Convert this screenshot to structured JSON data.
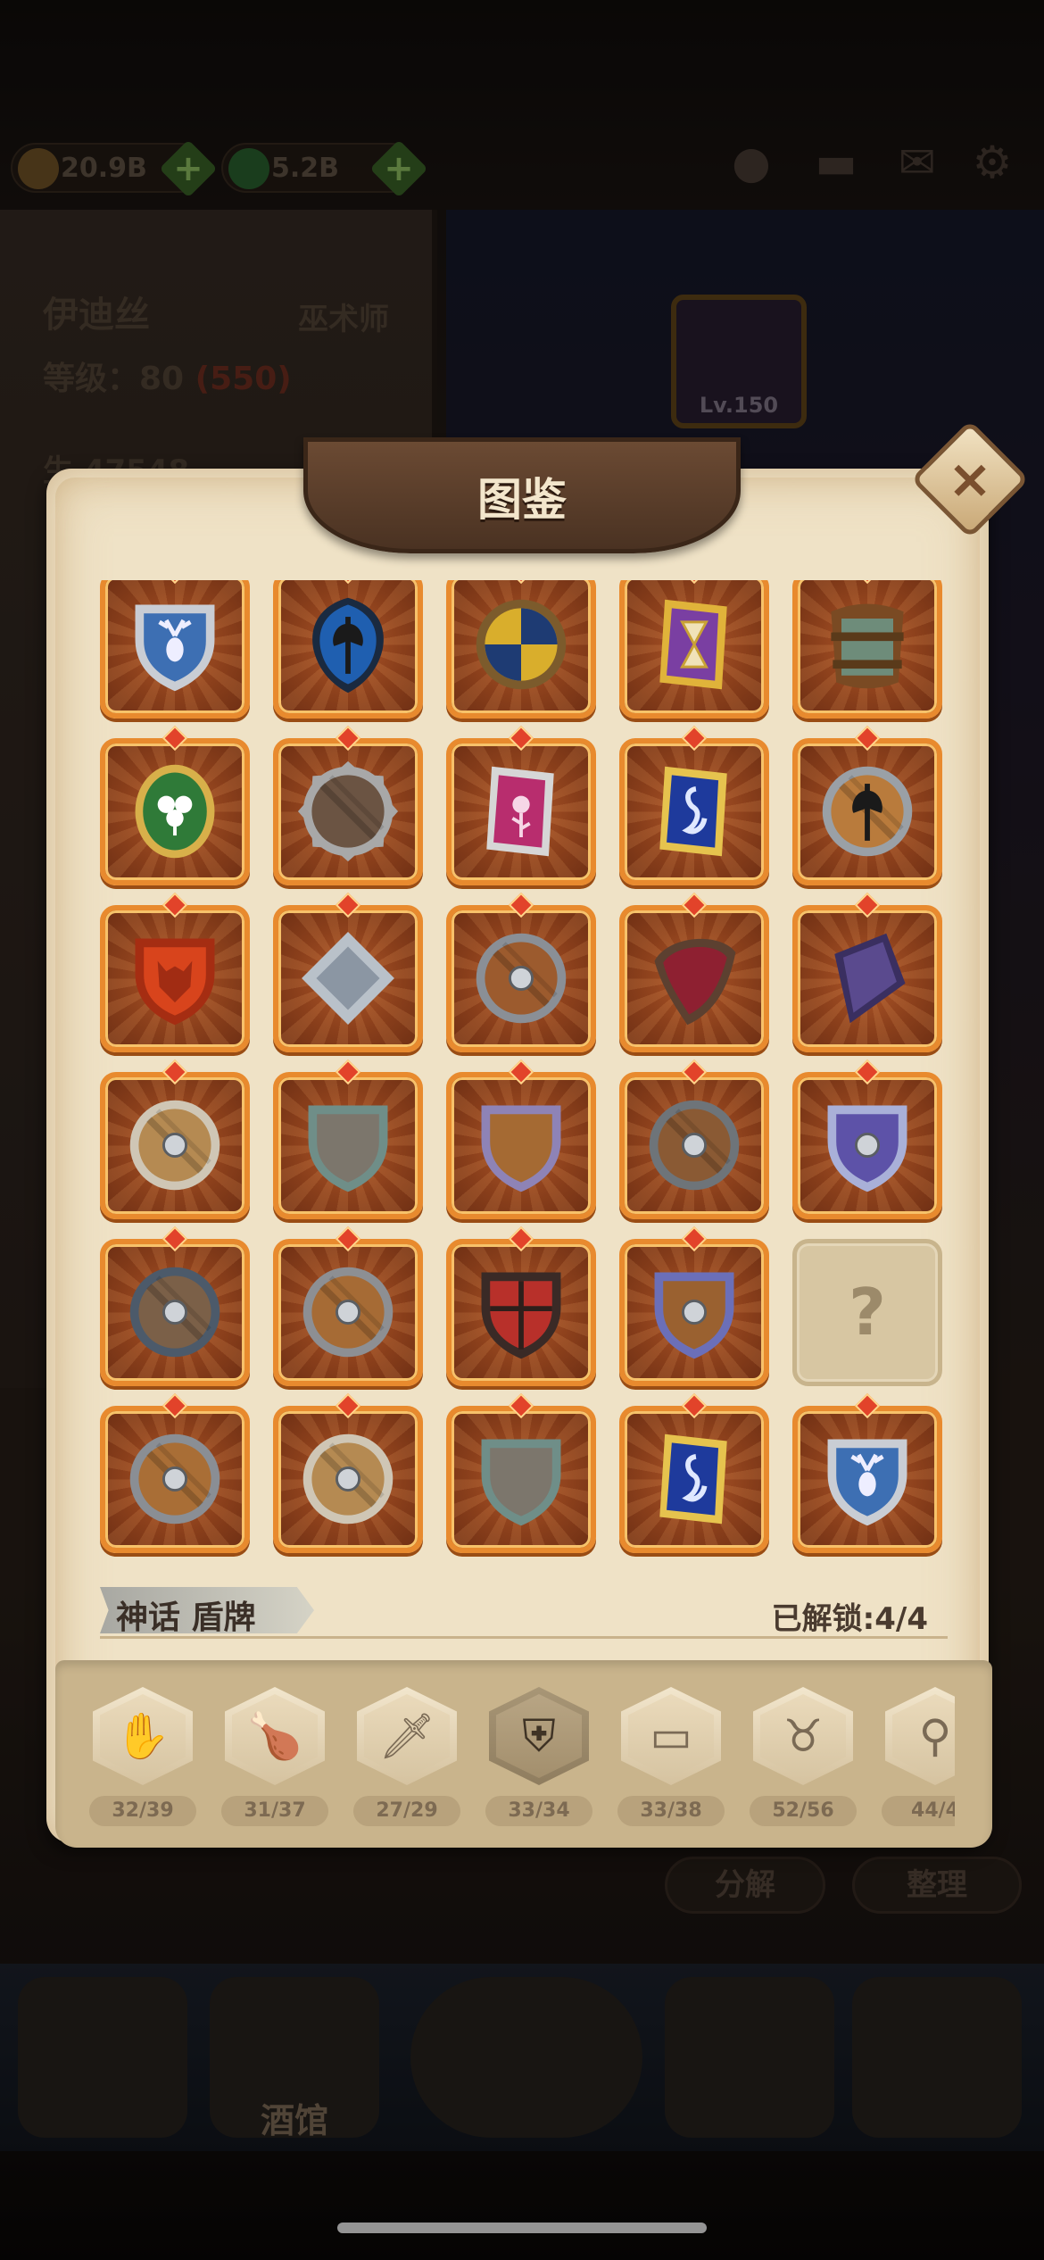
{
  "currency": {
    "gold": "20.9B",
    "gems": "5.2B"
  },
  "hero": {
    "name": "伊迪丝",
    "class": "巫术师",
    "level_label": "等级：80",
    "level_extra": "(550)",
    "stat_fragment": "生  47548"
  },
  "lv_badge": "Lv.150",
  "modal": {
    "title": "图鉴",
    "close": "×"
  },
  "collection": {
    "category_name": "神话 盾牌",
    "unlocked": "已解锁:4/4",
    "items": [
      {
        "name": "stag-heater-shield",
        "kind": "heater",
        "fill": "#3d6fb3",
        "rim": "#c9cdd4",
        "emblem": "stag"
      },
      {
        "name": "axe-kite-shield",
        "kind": "kite",
        "fill": "#1f5fb0",
        "rim": "#1a2a40",
        "emblem": "axe"
      },
      {
        "name": "yellow-blue-round-shield",
        "kind": "quad",
        "fill": "#d9ae2c",
        "rim": "#7c5b2c",
        "alt": "#1e3b73"
      },
      {
        "name": "hourglass-shield",
        "kind": "tall",
        "fill": "#7a3fa2",
        "rim": "#e0b33a",
        "emblem": "hourglass"
      },
      {
        "name": "barrel-shield",
        "kind": "barrel",
        "fill": "#6e8c7a",
        "rim": "#7a4a23"
      },
      {
        "name": "clover-oval-shield",
        "kind": "oval",
        "fill": "#2f7a38",
        "rim": "#d8b04a",
        "emblem": "clover"
      },
      {
        "name": "spiked-stone-shield",
        "kind": "spiked",
        "fill": "#6b5443",
        "rim": "#a8a8a8"
      },
      {
        "name": "rose-banner-shield",
        "kind": "tall",
        "fill": "#b82d6e",
        "rim": "#d6d6d6",
        "emblem": "rose"
      },
      {
        "name": "seahorse-tower-shield",
        "kind": "tower",
        "fill": "#1e3a9c",
        "rim": "#e6c34e",
        "emblem": "seahorse"
      },
      {
        "name": "axe-round-shield",
        "kind": "round",
        "fill": "#b97b3c",
        "rim": "#9aa0a6",
        "emblem": "axe"
      },
      {
        "name": "wolf-heater-shield",
        "kind": "heater",
        "fill": "#d8441c",
        "rim": "#a52d12",
        "emblem": "wolf"
      },
      {
        "name": "steel-square-shield",
        "kind": "square",
        "fill": "#8b96a3",
        "rim": "#b9c1c9"
      },
      {
        "name": "boss-wood-round-shield",
        "kind": "round",
        "fill": "#9c5b2e",
        "rim": "#8a8f96",
        "emblem": "boss"
      },
      {
        "name": "crimson-crescent-shield",
        "kind": "crescent",
        "fill": "#8e2031",
        "rim": "#5c4030"
      },
      {
        "name": "violet-slab-shield",
        "kind": "slab",
        "fill": "#5a4a8e",
        "rim": "#3a2f60"
      },
      {
        "name": "bronze-buckler",
        "kind": "round",
        "fill": "#b58a52",
        "rim": "#cfc6b5",
        "emblem": "boss"
      },
      {
        "name": "stone-heater-shield",
        "kind": "heater",
        "fill": "#7c766c",
        "rim": "#6f8e88"
      },
      {
        "name": "plank-heater-shield",
        "kind": "heater",
        "fill": "#a56a33",
        "rim": "#8e83b6"
      },
      {
        "name": "iron-boss-round-shield",
        "kind": "round",
        "fill": "#8a5a34",
        "rim": "#6e7479",
        "emblem": "boss"
      },
      {
        "name": "violet-boss-shield",
        "kind": "heater",
        "fill": "#5d52a8",
        "rim": "#a9b0d8",
        "emblem": "boss"
      },
      {
        "name": "dark-wood-round-shield",
        "kind": "round",
        "fill": "#7b6048",
        "rim": "#4c5a6a",
        "emblem": "boss"
      },
      {
        "name": "riveted-round-shield",
        "kind": "round",
        "fill": "#a66b35",
        "rim": "#8d8f93",
        "emblem": "boss"
      },
      {
        "name": "red-quartered-shield",
        "kind": "heater",
        "fill": "#b8302a",
        "rim": "#3a2a26",
        "emblem": "quarter"
      },
      {
        "name": "blue-rim-heater-shield",
        "kind": "heater",
        "fill": "#9a6130",
        "rim": "#6b6fb8",
        "emblem": "boss"
      },
      {
        "name": "locked-slot",
        "locked": true,
        "label": "?"
      },
      {
        "name": "spiked-boss-round-shield",
        "kind": "round",
        "fill": "#a96e36",
        "rim": "#8a8e94",
        "emblem": "boss"
      },
      {
        "name": "bronze-buckler-2",
        "kind": "round",
        "fill": "#b58a52",
        "rim": "#cfc6b5",
        "emblem": "boss"
      },
      {
        "name": "stone-heater-shield-2",
        "kind": "heater",
        "fill": "#7c766c",
        "rim": "#6f8e88"
      },
      {
        "name": "seahorse-tower-shield-2",
        "kind": "tower",
        "fill": "#1e3a9c",
        "rim": "#e6c34e",
        "emblem": "seahorse"
      },
      {
        "name": "stag-heater-shield-2",
        "kind": "heater",
        "fill": "#3d6fb3",
        "rim": "#c9cdd4",
        "emblem": "stag"
      }
    ]
  },
  "categories": [
    {
      "name": "gloves",
      "glyph": "✋",
      "count": "32/39"
    },
    {
      "name": "club",
      "glyph": "🍗",
      "count": "31/37"
    },
    {
      "name": "sword",
      "glyph": "🗡",
      "count": "27/29"
    },
    {
      "name": "shield",
      "glyph": "⛨",
      "count": "33/34",
      "active": true
    },
    {
      "name": "book",
      "glyph": "▭",
      "count": "33/38"
    },
    {
      "name": "helmet",
      "glyph": "♉",
      "count": "52/56"
    },
    {
      "name": "staff",
      "glyph": "⚲",
      "count": "44/4"
    }
  ],
  "bottom_buttons": {
    "decompose": "分解",
    "organize": "整理"
  },
  "nav": {
    "tavern": "酒馆"
  }
}
